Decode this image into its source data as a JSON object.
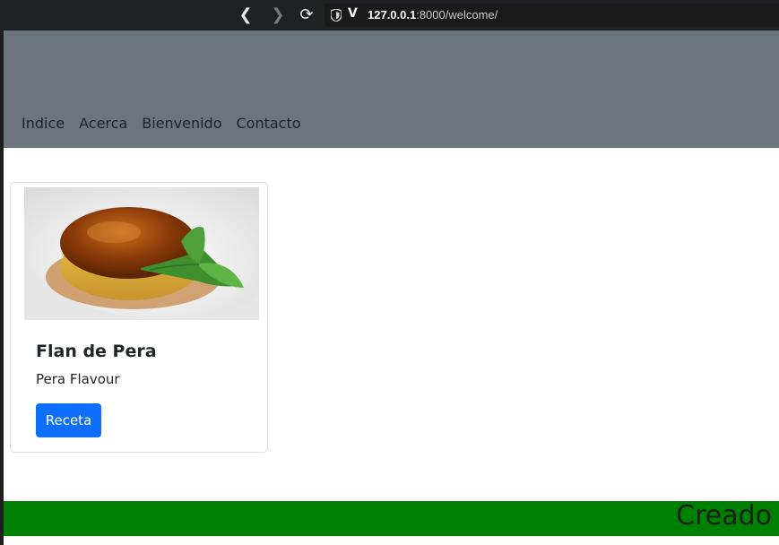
{
  "browser": {
    "url_host": "127.0.0.1",
    "url_rest": ":8000/welcome/"
  },
  "nav": {
    "items": [
      {
        "label": "Indice"
      },
      {
        "label": "Acerca"
      },
      {
        "label": "Bienvenido"
      },
      {
        "label": "Contacto"
      }
    ]
  },
  "card": {
    "title": "Flan de Pera",
    "text": "Pera Flavour",
    "button_label": "Receta"
  },
  "footer": {
    "text": "Creado"
  },
  "colors": {
    "header_bg": "#6c757d",
    "button_bg": "#0d6efd",
    "footer_bg": "#008000"
  }
}
